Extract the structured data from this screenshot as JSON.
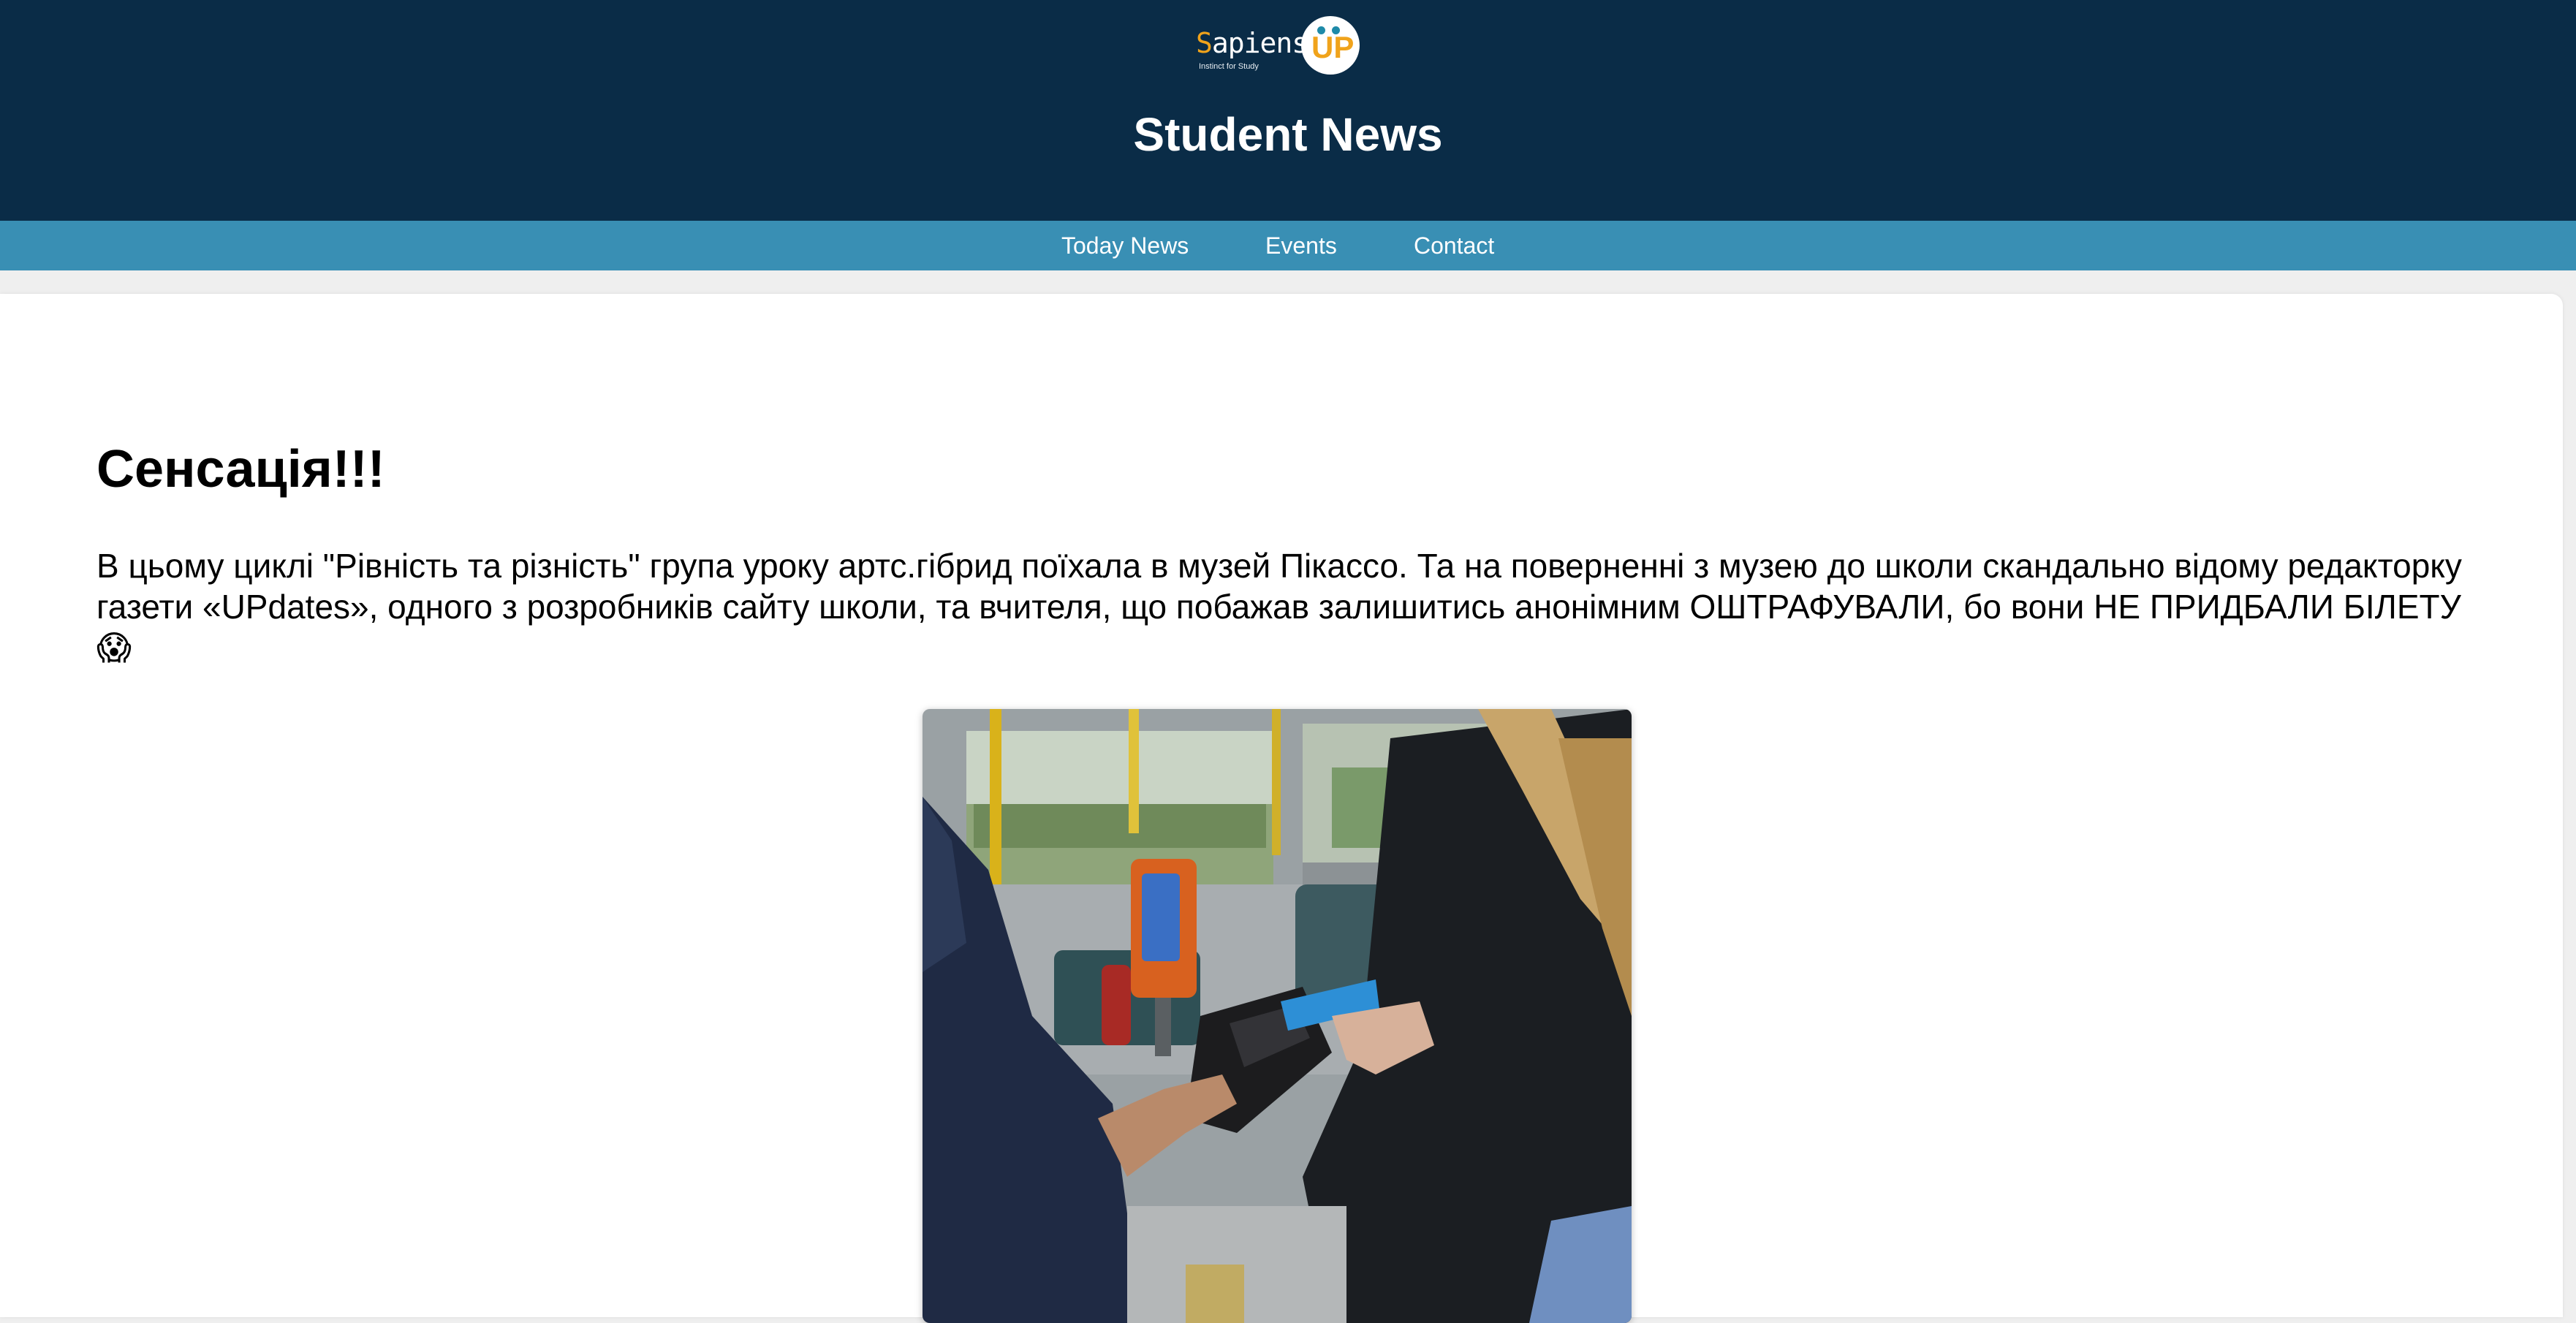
{
  "header": {
    "logo": {
      "first_letter": "S",
      "rest": "apiens",
      "badge_text": "UP",
      "tagline": "Instinct for Study"
    },
    "title": "Student News"
  },
  "nav": {
    "items": [
      {
        "label": "Today News"
      },
      {
        "label": "Events"
      },
      {
        "label": "Contact"
      }
    ]
  },
  "article": {
    "title": "Сенсація!!!",
    "body": "В цьому циклі \"Рівність та різність\" група уроку артс.гібрид поїхала в музей Пікассо. Та на поверненні з музею до школи скандально відому редакторку газети «UPdates», одного з розробників сайту школи, та вчителя, що побажав залишитись анонімним ОШТРАФУВАЛИ, бо вони НЕ ПРИДБАЛИ БІЛЕТУ 😱",
    "image": {
      "subject": "ticket inspection on a tram"
    }
  },
  "colors": {
    "header_bg": "#0a2c47",
    "nav_bg": "#398fb4",
    "page_bg": "#efefef",
    "accent_orange": "#f0a31b"
  }
}
